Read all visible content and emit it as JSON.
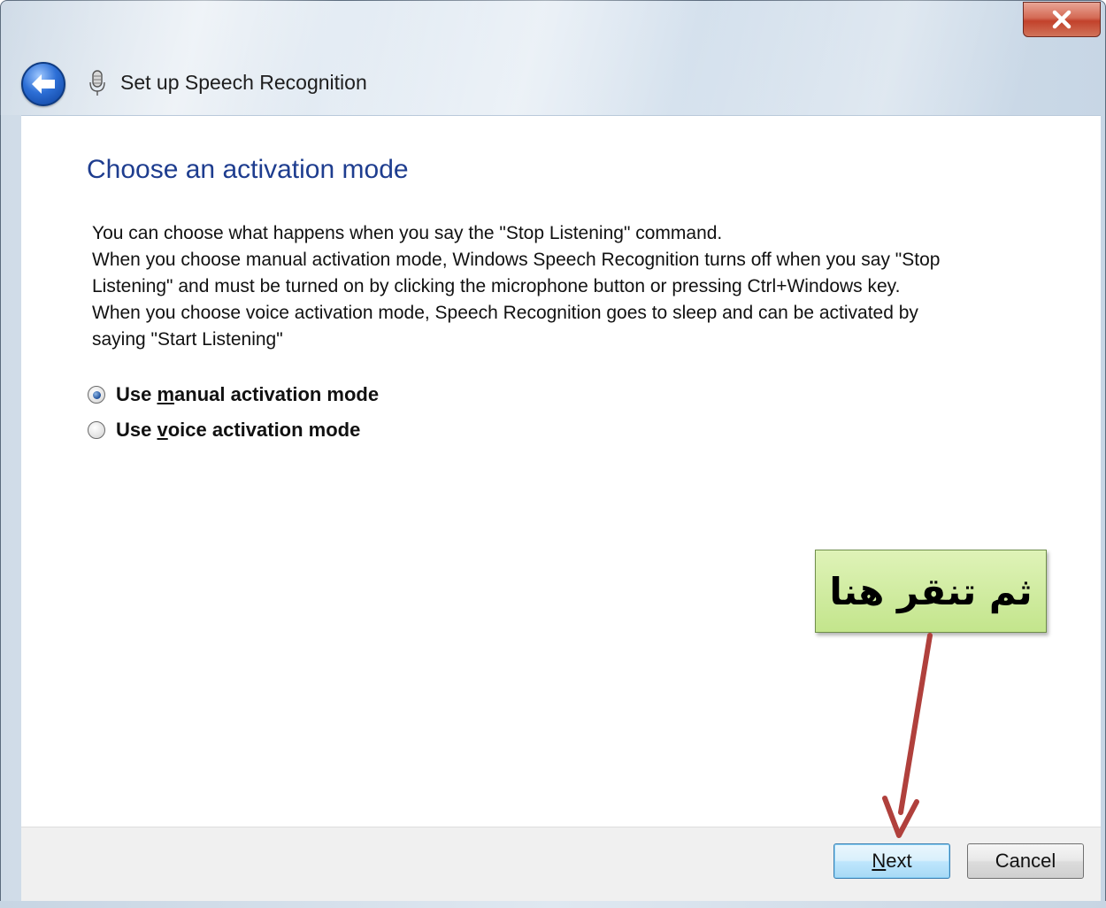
{
  "window": {
    "title": "Set up Speech Recognition",
    "close_label": "X"
  },
  "page": {
    "heading": "Choose an activation mode",
    "description_lines": [
      "You can choose what happens when you say the \"Stop Listening\" command.",
      "When you choose manual activation mode, Windows Speech Recognition turns off when you say \"Stop",
      "Listening\" and must be turned on by clicking the microphone button or pressing Ctrl+Windows key.",
      "When you choose voice activation mode, Speech Recognition goes to sleep and can be activated by",
      "saying \"Start Listening\""
    ],
    "options": [
      {
        "prefix": "Use ",
        "accel": "m",
        "rest": "anual activation mode",
        "selected": true
      },
      {
        "prefix": "Use ",
        "accel": "v",
        "rest": "oice activation mode",
        "selected": false
      }
    ]
  },
  "annotation": {
    "callout_text": "ثم تنقر هنا",
    "arrow_color": "#b0403c",
    "callout_color": "#c3e58c"
  },
  "footer": {
    "next": {
      "accel": "N",
      "rest": "ext"
    },
    "cancel_label": "Cancel"
  },
  "colors": {
    "heading": "#1e3d8f",
    "close_button": "#c2412b",
    "next_button_border": "#3c7fb1"
  }
}
